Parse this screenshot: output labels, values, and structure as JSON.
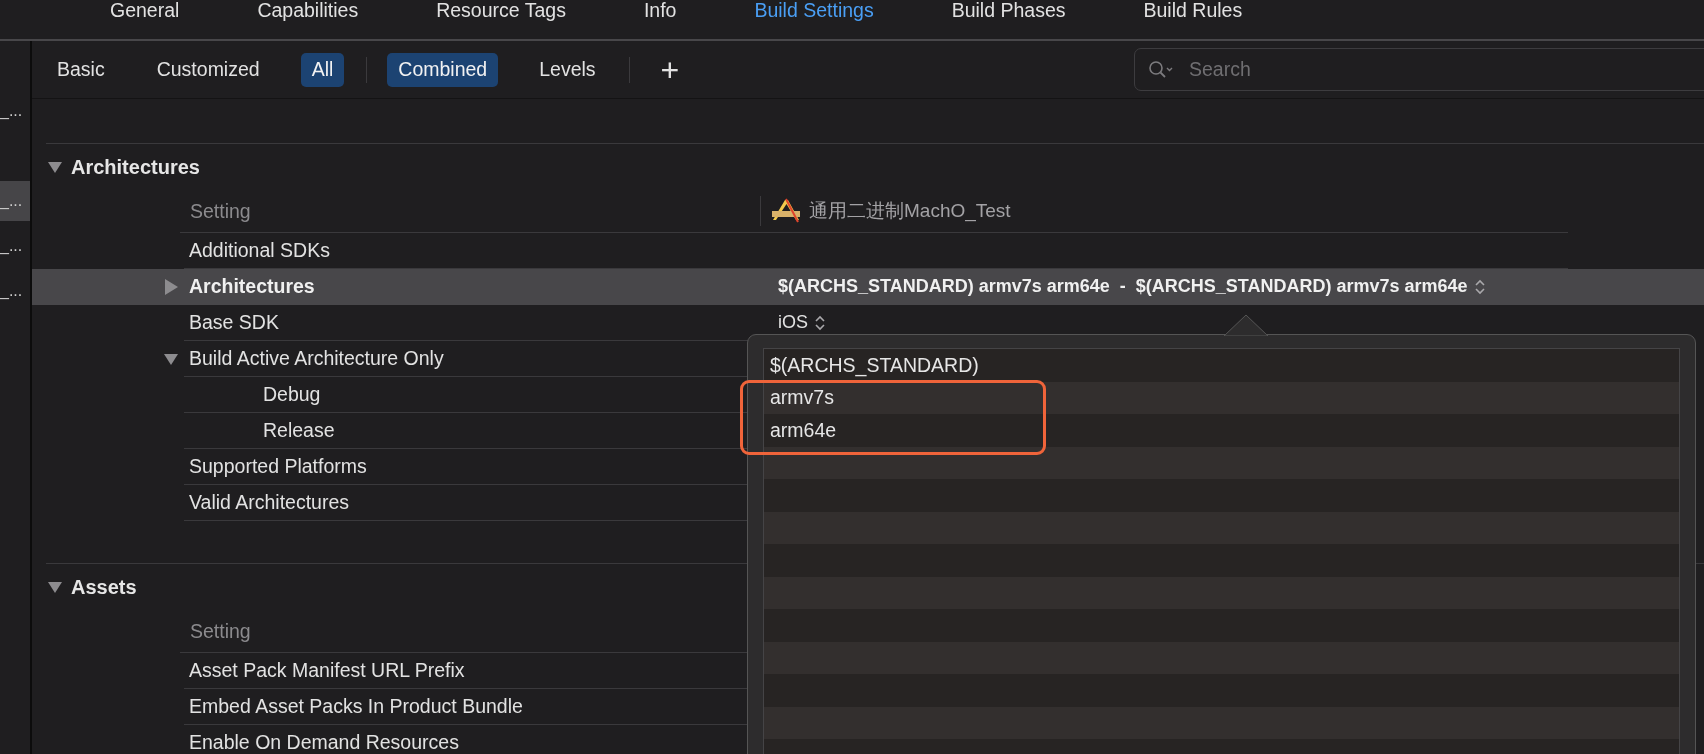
{
  "tabs": [
    {
      "label": "General",
      "selected": false
    },
    {
      "label": "Capabilities",
      "selected": false
    },
    {
      "label": "Resource Tags",
      "selected": false
    },
    {
      "label": "Info",
      "selected": false
    },
    {
      "label": "Build Settings",
      "selected": true
    },
    {
      "label": "Build Phases",
      "selected": false
    },
    {
      "label": "Build Rules",
      "selected": false
    }
  ],
  "sidebar": {
    "items": [
      {
        "label": "_...",
        "selected": false
      },
      {
        "label": "_...",
        "selected": true
      },
      {
        "label": "_...",
        "selected": false
      },
      {
        "label": "_...",
        "selected": false
      }
    ]
  },
  "filter_bar": {
    "scopes": [
      {
        "label": "Basic",
        "selected": false
      },
      {
        "label": "Customized",
        "selected": false
      },
      {
        "label": "All",
        "selected": true
      }
    ],
    "views": [
      {
        "label": "Combined",
        "selected": true
      },
      {
        "label": "Levels",
        "selected": false
      }
    ],
    "add": "+",
    "search": {
      "placeholder": "Search"
    }
  },
  "sections": [
    {
      "title": "Architectures",
      "expanded": true,
      "setting_label": "Setting",
      "target": "通用二进制MachO_Test",
      "rows": [
        {
          "name": "Additional SDKs",
          "selected": false
        },
        {
          "name": "Architectures",
          "selected": true,
          "expanded": false,
          "value": "$(ARCHS_STANDARD) armv7s arm64e  -  $(ARCHS_STANDARD) armv7s arm64e"
        },
        {
          "name": "Base SDK",
          "selected": false,
          "value": "iOS"
        },
        {
          "name": "Build Active Architecture Only",
          "selected": false,
          "expanded": true,
          "children": [
            {
              "name": "Debug",
              "selected": false
            },
            {
              "name": "Release",
              "selected": false
            }
          ]
        },
        {
          "name": "Supported Platforms",
          "selected": false
        },
        {
          "name": "Valid Architectures",
          "selected": false
        }
      ]
    },
    {
      "title": "Assets",
      "expanded": true,
      "setting_label": "Setting",
      "rows": [
        {
          "name": "Asset Pack Manifest URL Prefix",
          "selected": false
        },
        {
          "name": "Embed Asset Packs In Product Bundle",
          "selected": false
        },
        {
          "name": "Enable On Demand Resources",
          "selected": false
        }
      ]
    }
  ],
  "popover": {
    "items": [
      {
        "label": "$(ARCHS_STANDARD)",
        "highlighted": false
      },
      {
        "label": "armv7s",
        "highlighted": true
      },
      {
        "label": "arm64e",
        "highlighted": true
      }
    ]
  }
}
